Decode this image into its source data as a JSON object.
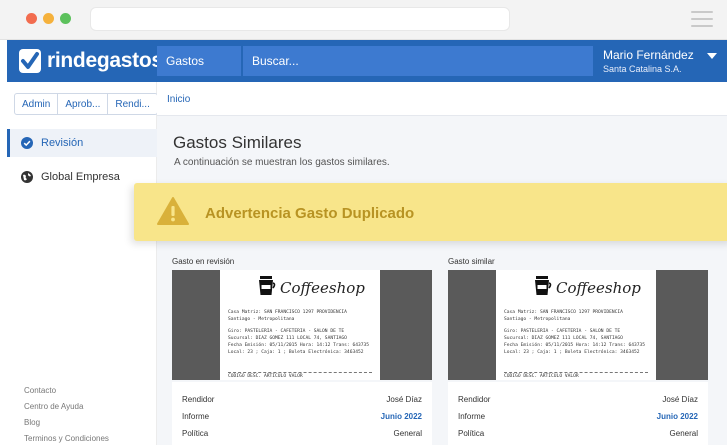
{
  "app": {
    "logo_text": "rindegastos",
    "module_field": "Gastos",
    "search_placeholder": "Buscar...",
    "user_name": "Mario Fernández",
    "user_company": "Santa Catalina S.A."
  },
  "sidebar": {
    "segments": [
      "Admin",
      "Aprob...",
      "Rendi..."
    ],
    "items": [
      {
        "label": "Revisión",
        "icon": "check-circle-icon",
        "active": true
      },
      {
        "label": "Global Empresa",
        "icon": "globe-icon",
        "active": false
      }
    ],
    "footer_links": [
      "Contacto",
      "Centro de Ayuda",
      "Blog",
      "Terminos y Condiciones"
    ]
  },
  "main": {
    "breadcrumb": "Inicio",
    "title": "Gastos Similares",
    "subtitle": "A continuación se muestran los gastos similares."
  },
  "warning": {
    "text": "Advertencia Gasto Duplicado",
    "color": "#f8e58a",
    "text_color": "#b89323"
  },
  "cards": [
    {
      "label": "Gasto en revisión",
      "receipt": {
        "brand": "Coffeeshop",
        "lines": [
          "Casa Matriz: SAN FRANCISCO 1297 PROVIDENCIA",
          "Santiago - Metropolitana",
          "Giro: PASTELERIA - CAFETERIA - SALON DE TE",
          "Sucursal: DIAZ GOMEZ 111 LOCAL 74, SANTIAGO",
          "Fecha Emisión: 05/11/2015 Hora: 14:12 Trans: 643735",
          "Local: 23 ; Caja: 1 ; Boleta Electrónica: 3463452",
          "CODIGO     DESC. ARTICULO                VALOR"
        ]
      },
      "rows": [
        {
          "key": "Rendidor",
          "value": "José Díaz"
        },
        {
          "key": "Informe",
          "value": "Junio 2022"
        },
        {
          "key": "Política",
          "value": "General"
        }
      ]
    },
    {
      "label": "Gasto similar",
      "receipt": {
        "brand": "Coffeeshop",
        "lines": [
          "Casa Matriz: SAN FRANCISCO 1297 PROVIDENCIA",
          "Santiago - Metropolitana",
          "Giro: PASTELERIA - CAFETERIA - SALON DE TE",
          "Sucursal: DIAZ GOMEZ 111 LOCAL 74, SANTIAGO",
          "Fecha Emisión: 05/11/2015 Hora: 14:12 Trans: 643735",
          "Local: 23 ; Caja: 1 ; Boleta Electrónica: 3463452",
          "CODIGO     DESC. ARTICULO                VALOR"
        ]
      },
      "rows": [
        {
          "key": "Rendidor",
          "value": "José Díaz"
        },
        {
          "key": "Informe",
          "value": "Junio 2022"
        },
        {
          "key": "Política",
          "value": "General"
        }
      ]
    }
  ],
  "colors": {
    "brand_blue": "#2566b6",
    "mac_red": "#f26c4f",
    "mac_yellow": "#f5b13c",
    "mac_green": "#5cc15c"
  }
}
